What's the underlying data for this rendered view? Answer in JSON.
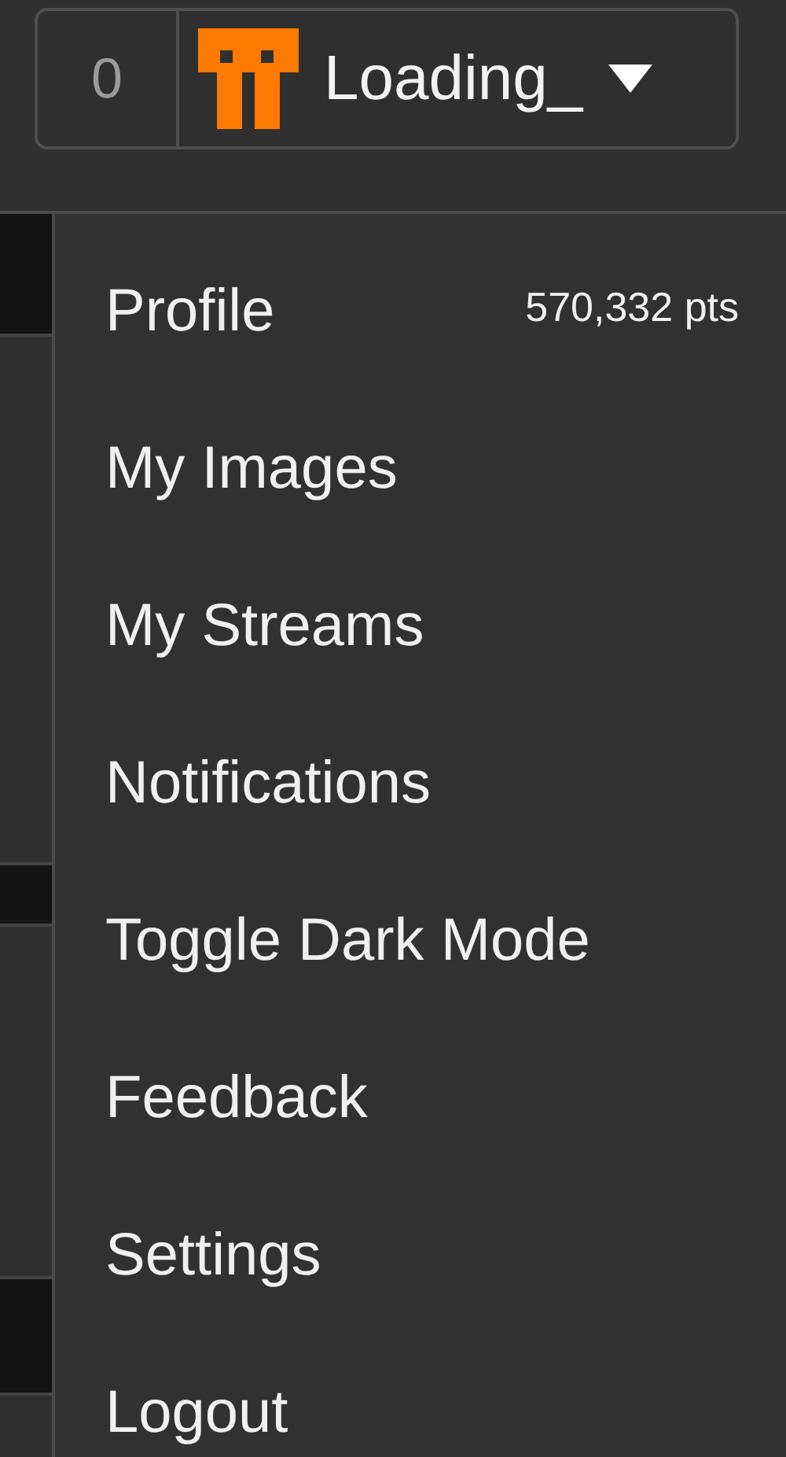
{
  "header": {
    "count": "0",
    "username": "Loading_"
  },
  "menu": {
    "expanded": true,
    "items": [
      {
        "label": "Profile",
        "points": "570,332 pts"
      },
      {
        "label": "My Images"
      },
      {
        "label": "My Streams"
      },
      {
        "label": "Notifications"
      },
      {
        "label": "Toggle Dark Mode"
      },
      {
        "label": "Feedback"
      },
      {
        "label": "Settings"
      },
      {
        "label": "Logout"
      }
    ]
  }
}
